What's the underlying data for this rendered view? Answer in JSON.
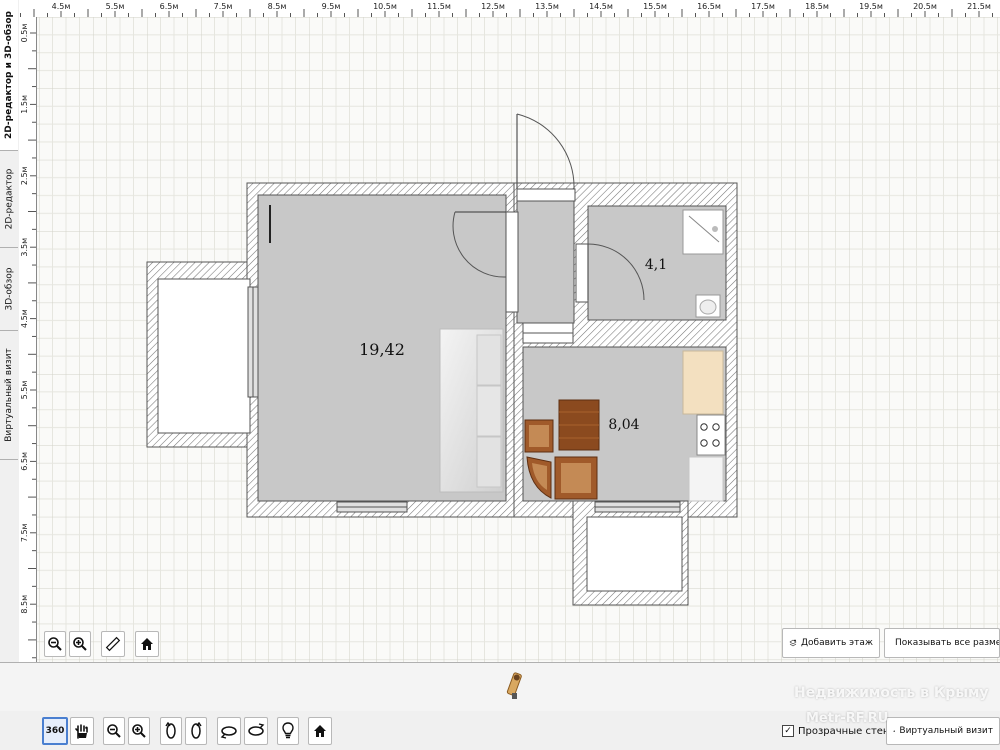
{
  "tabs": [
    {
      "label": "2D-редактор и 3D-обзор",
      "active": true
    },
    {
      "label": "2D-редактор",
      "active": false
    },
    {
      "label": "3D-обзор",
      "active": false
    },
    {
      "label": "Виртуальный визит",
      "active": false
    }
  ],
  "ruler_top": [
    "4.5м",
    "5.5м",
    "6.5м",
    "7.5м",
    "8.5м",
    "9.5м",
    "10.5м",
    "11.5м",
    "12.5м",
    "13.5м",
    "14.5м",
    "15.5м",
    "16.5м",
    "17.5м",
    "18.5м",
    "19.5м",
    "20.5м",
    "21.5м"
  ],
  "ruler_left": [
    "0.5м",
    "1.5м",
    "2.5м",
    "3.5м",
    "4.5м",
    "5.5м",
    "6.5м",
    "7.5м",
    "8.5м"
  ],
  "rooms": {
    "living": "19,42",
    "bath": "4,1",
    "kitchen": "8,04"
  },
  "canvas_buttons": {
    "add_floor": "Добавить этаж",
    "show_all_sizes": "Показывать все размеры"
  },
  "toolbar": {
    "mode_360": "360",
    "transparent_walls": "Прозрачные стены",
    "transparent_checked": true,
    "virtual_visit": "Виртуальный визит"
  },
  "watermark": {
    "line1": "Недвижимость в Крыму",
    "line2": "Metr-RF.RU"
  },
  "colors": {
    "floor": "#c8c8c8",
    "grid": "#dcdcd2",
    "wall": "#909090",
    "wood": "#8b4a1f"
  }
}
